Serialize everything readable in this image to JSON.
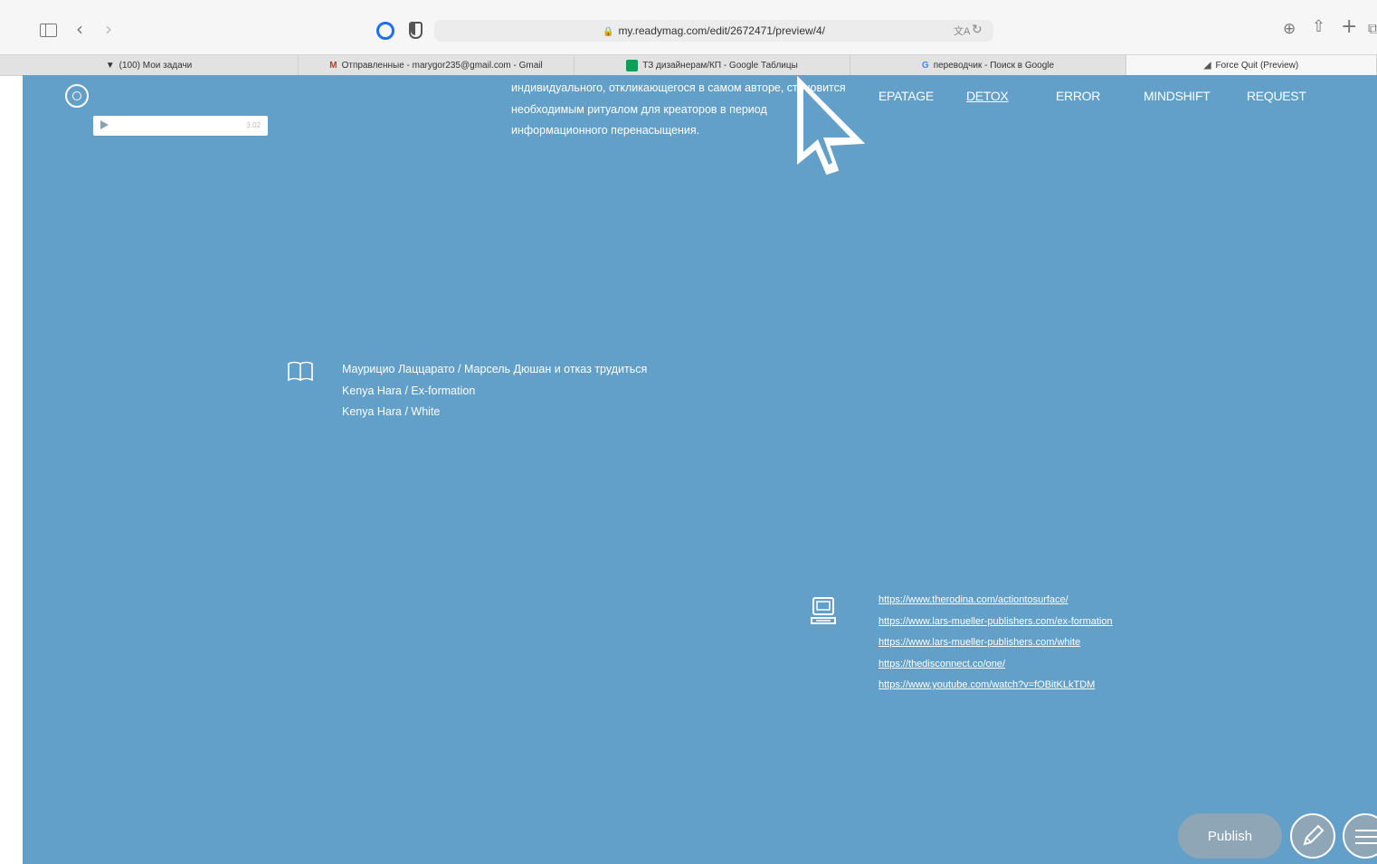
{
  "browser": {
    "url": "my.readymag.com/edit/2672471/preview/4/",
    "tabs": [
      {
        "label": "(100) Мои задачи",
        "icon": "task-icon"
      },
      {
        "label": "Отправленные - marygor235@gmail.com - Gmail",
        "icon": "gmail-icon",
        "icon_text": "M",
        "icon_color": "#d93025"
      },
      {
        "label": "ТЗ дизайнерам/КП - Google Таблицы",
        "icon": "sheets-icon",
        "icon_color": "#0f9d58"
      },
      {
        "label": "переводчик - Поиск в Google",
        "icon": "google-icon",
        "icon_text": "G",
        "icon_color": "#4285f4"
      },
      {
        "label": "Force Quit (Preview)",
        "icon": "preview-icon"
      }
    ]
  },
  "page": {
    "background": "#629fc9",
    "intro_lines": [
      "индивидуального, откликающегося в самом авторе, становится",
      "необходимым ритуалом для креаторов в период",
      "информационного перенасыщения."
    ],
    "nav": [
      {
        "label": "EPATAGE",
        "active": false
      },
      {
        "label": "DETOX",
        "active": true
      },
      {
        "label": "ERROR",
        "active": false
      },
      {
        "label": "MINDSHIFT",
        "active": false
      },
      {
        "label": "REQUEST",
        "active": false
      }
    ],
    "audio_time": "3:02",
    "references": [
      "Маурицио Лаццарато / Марсель Дюшан и отказ трудиться",
      "Kenya Hara / Ex-formation",
      "Kenya Hara / White"
    ],
    "links": [
      "https://www.therodina.com/actiontosurface/",
      "https://www.lars-mueller-publishers.com/ex-formation",
      "https://www.lars-mueller-publishers.com/white",
      "https://thedisconnect.co/one/",
      "https://www.youtube.com/watch?v=fOBitKLkTDM"
    ],
    "publish_label": "Publish"
  }
}
